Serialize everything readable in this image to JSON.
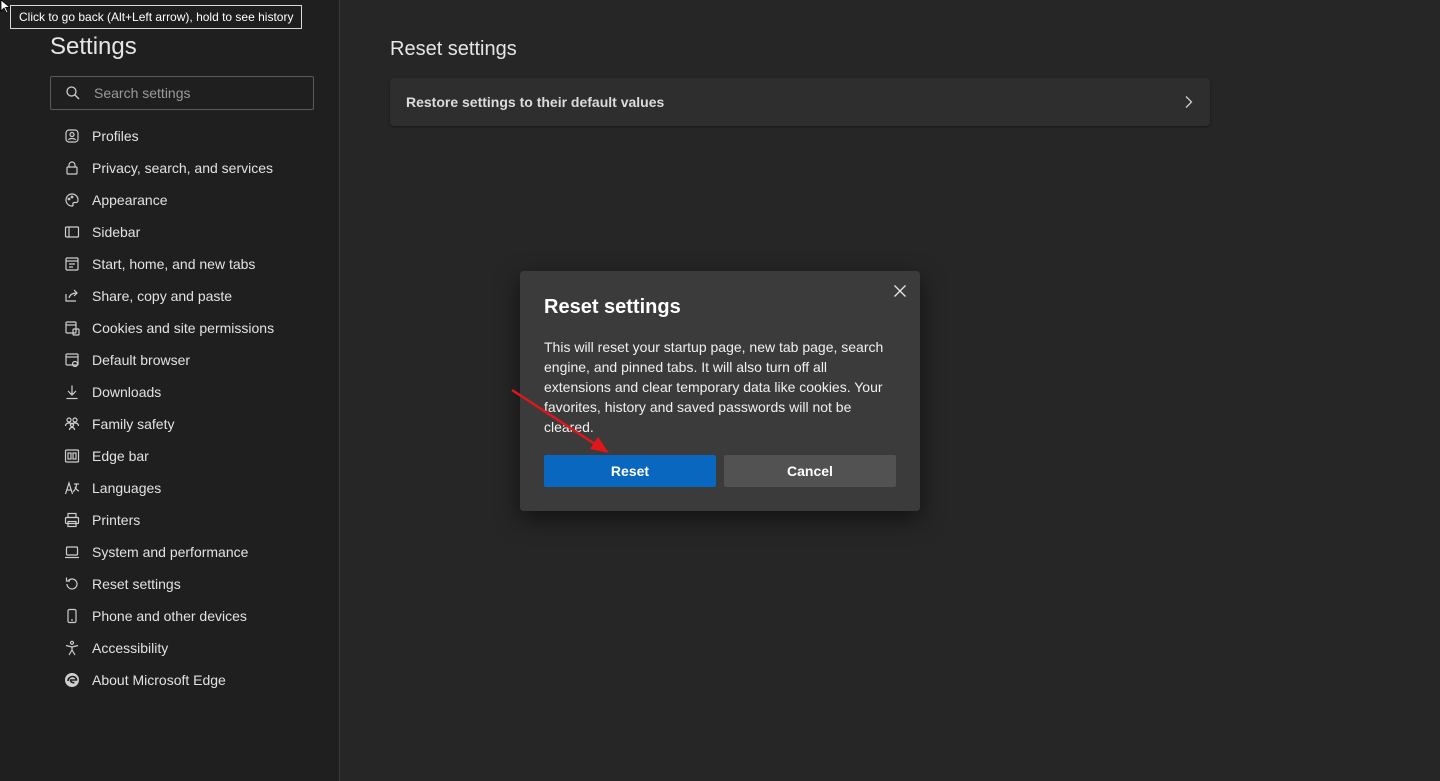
{
  "tooltip": {
    "text": "Click to go back (Alt+Left arrow), hold to see history"
  },
  "sidebar": {
    "title": "Settings",
    "search_placeholder": "Search settings",
    "items": [
      {
        "label": "Profiles",
        "icon": "profile-icon"
      },
      {
        "label": "Privacy, search, and services",
        "icon": "lock-icon"
      },
      {
        "label": "Appearance",
        "icon": "palette-icon"
      },
      {
        "label": "Sidebar",
        "icon": "sidebar-icon"
      },
      {
        "label": "Start, home, and new tabs",
        "icon": "home-tabs-icon"
      },
      {
        "label": "Share, copy and paste",
        "icon": "share-icon"
      },
      {
        "label": "Cookies and site permissions",
        "icon": "cookies-icon"
      },
      {
        "label": "Default browser",
        "icon": "browser-icon"
      },
      {
        "label": "Downloads",
        "icon": "download-icon"
      },
      {
        "label": "Family safety",
        "icon": "family-icon"
      },
      {
        "label": "Edge bar",
        "icon": "edge-bar-icon"
      },
      {
        "label": "Languages",
        "icon": "languages-icon"
      },
      {
        "label": "Printers",
        "icon": "printer-icon"
      },
      {
        "label": "System and performance",
        "icon": "laptop-icon"
      },
      {
        "label": "Reset settings",
        "icon": "reset-icon"
      },
      {
        "label": "Phone and other devices",
        "icon": "phone-icon"
      },
      {
        "label": "Accessibility",
        "icon": "accessibility-icon"
      },
      {
        "label": "About Microsoft Edge",
        "icon": "edge-logo-icon"
      }
    ]
  },
  "main": {
    "title": "Reset settings",
    "card_label": "Restore settings to their default values"
  },
  "dialog": {
    "title": "Reset settings",
    "body": "This will reset your startup page, new tab page, search engine, and pinned tabs. It will also turn off all extensions and clear temporary data like cookies. Your favorites, history and saved passwords will not be cleared.",
    "reset_label": "Reset",
    "cancel_label": "Cancel"
  },
  "colors": {
    "accent": "#0a67c0",
    "annotation_arrow": "#e0161b",
    "background": "#262626",
    "sidebar_bg": "#1f1f1f",
    "dialog_bg": "#3b3b3b"
  }
}
